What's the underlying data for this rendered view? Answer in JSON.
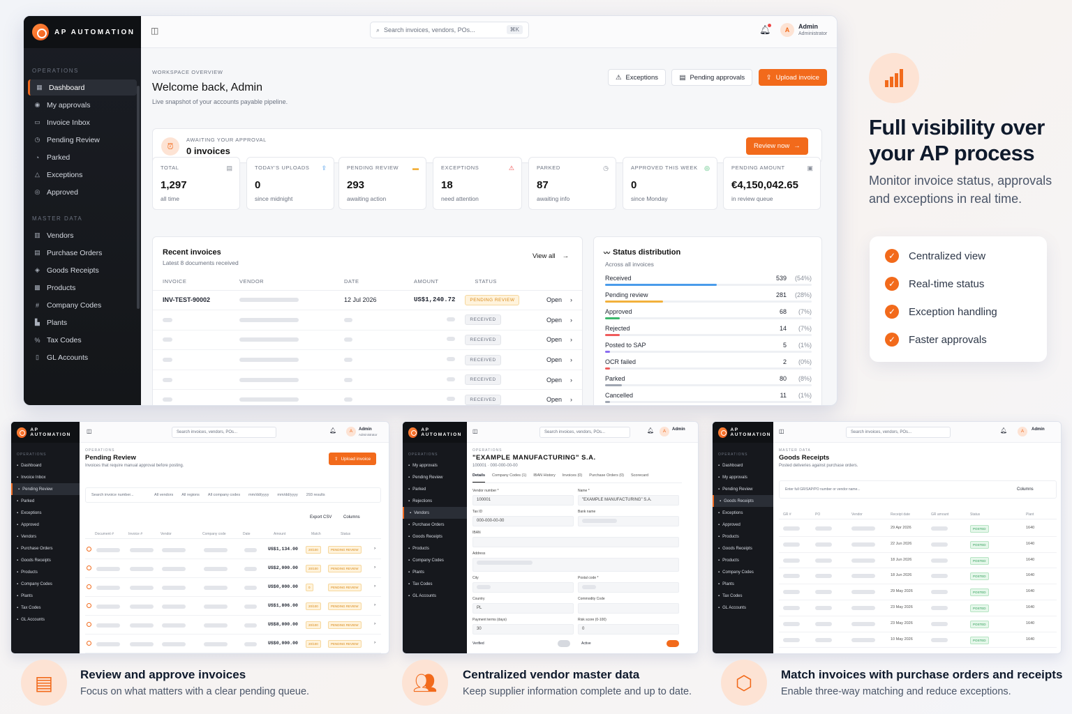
{
  "app": {
    "brand": "AP AUTOMATION",
    "search_placeholder": "Search invoices, vendors, POs...",
    "shortcut": "⌘K",
    "user_initial": "A",
    "user_name": "Admin",
    "user_role": "Administrator"
  },
  "sidebar": {
    "section_ops": "OPERATIONS",
    "section_master": "MASTER DATA",
    "ops": [
      {
        "label": "Dashboard",
        "icon": "grid-icon"
      },
      {
        "label": "My approvals",
        "icon": "user-check-icon"
      },
      {
        "label": "Invoice Inbox",
        "icon": "inbox-icon"
      },
      {
        "label": "Pending Review",
        "icon": "clock-icon"
      },
      {
        "label": "Parked",
        "icon": "pause-icon"
      },
      {
        "label": "Exceptions",
        "icon": "warning-icon"
      },
      {
        "label": "Approved",
        "icon": "check-circle-icon"
      }
    ],
    "master": [
      {
        "label": "Vendors",
        "icon": "building-icon"
      },
      {
        "label": "Purchase Orders",
        "icon": "document-icon"
      },
      {
        "label": "Goods Receipts",
        "icon": "box-icon"
      },
      {
        "label": "Products",
        "icon": "cubes-icon"
      },
      {
        "label": "Company Codes",
        "icon": "hash-icon"
      },
      {
        "label": "Plants",
        "icon": "factory-icon"
      },
      {
        "label": "Tax Codes",
        "icon": "percent-icon"
      },
      {
        "label": "GL Accounts",
        "icon": "book-icon"
      }
    ]
  },
  "header": {
    "eyebrow": "WORKSPACE OVERVIEW",
    "title": "Welcome back, Admin",
    "subtitle": "Live snapshot of your accounts payable pipeline.",
    "btn_exceptions": "Exceptions",
    "btn_pending": "Pending approvals",
    "btn_upload": "Upload invoice"
  },
  "approval": {
    "label": "AWAITING YOUR APPROVAL",
    "value": "0 invoices",
    "button": "Review now"
  },
  "stats": [
    {
      "label": "TOTAL",
      "value": "1,297",
      "sub": "all time"
    },
    {
      "label": "TODAY'S UPLOADS",
      "value": "0",
      "sub": "since midnight"
    },
    {
      "label": "PENDING REVIEW",
      "value": "293",
      "sub": "awaiting action"
    },
    {
      "label": "EXCEPTIONS",
      "value": "18",
      "sub": "need attention"
    },
    {
      "label": "PARKED",
      "value": "87",
      "sub": "awaiting info"
    },
    {
      "label": "APPROVED THIS WEEK",
      "value": "0",
      "sub": "since Monday"
    },
    {
      "label": "PENDING AMOUNT",
      "value": "€4,150,042.65",
      "sub": "in review queue"
    }
  ],
  "recent": {
    "title": "Recent invoices",
    "subtitle": "Latest 8 documents received",
    "view_all": "View all",
    "columns": [
      "INVOICE",
      "VENDOR",
      "DATE",
      "AMOUNT",
      "STATUS"
    ],
    "rows": [
      {
        "invoice": "INV-TEST-90002",
        "date": "12 Jul 2026",
        "amount": "US$1,240.72",
        "status": "PENDING REVIEW",
        "action": "Open"
      },
      {
        "status": "RECEIVED",
        "action": "Open"
      },
      {
        "status": "RECEIVED",
        "action": "Open"
      },
      {
        "status": "RECEIVED",
        "action": "Open"
      },
      {
        "status": "RECEIVED",
        "action": "Open"
      },
      {
        "status": "RECEIVED",
        "action": "Open"
      }
    ]
  },
  "distribution": {
    "title": "Status distribution",
    "subtitle": "Across all invoices",
    "items": [
      {
        "name": "Received",
        "count": "539",
        "pct": "(54%)",
        "frac": 0.54,
        "color": "#4a9bea"
      },
      {
        "name": "Pending review",
        "count": "281",
        "pct": "(28%)",
        "frac": 0.28,
        "color": "#f2b13c"
      },
      {
        "name": "Approved",
        "count": "68",
        "pct": "(7%)",
        "frac": 0.07,
        "color": "#3cb86b"
      },
      {
        "name": "Rejected",
        "count": "14",
        "pct": "(7%)",
        "frac": 0.07,
        "color": "#ef5b5b"
      },
      {
        "name": "Posted to SAP",
        "count": "5",
        "pct": "(1%)",
        "frac": 0.01,
        "color": "#8a6cf0"
      },
      {
        "name": "OCR failed",
        "count": "2",
        "pct": "(0%)",
        "frac": 0.005,
        "color": "#ef5b5b"
      },
      {
        "name": "Parked",
        "count": "80",
        "pct": "(8%)",
        "frac": 0.08,
        "color": "#a0a6b2"
      },
      {
        "name": "Cancelled",
        "count": "11",
        "pct": "(1%)",
        "frac": 0.01,
        "color": "#a0a6b2"
      }
    ]
  },
  "promo": {
    "title_line1": "Full visibility over",
    "title_line2": "your AP process",
    "sub_line1": "Monitor invoice status, approvals",
    "sub_line2": "and exceptions in real time.",
    "checks": [
      "Centralized view",
      "Real-time status",
      "Exception handling",
      "Faster approvals"
    ]
  },
  "mini1": {
    "eyebrow": "OPERATIONS",
    "title": "Pending Review",
    "subtitle": "Invoices that require manual approval before posting.",
    "upload": "Upload invoice",
    "search": "Search invoice number...",
    "f1": "All vendors",
    "f2": "All regions",
    "f3": "All company codes",
    "d1": "mm/dd/yyyy",
    "d2": "mm/dd/yyyy",
    "results": "293 results",
    "export": "Export CSV",
    "columns_btn": "Columns",
    "cols": [
      "Document #",
      "Invoice #",
      "Vendor",
      "Company code",
      "Date",
      "Amount",
      "Match",
      "Status"
    ],
    "amounts": [
      "US$1,134.00",
      "US$2,000.00",
      "US$0,000.00",
      "US$1,806.00",
      "US$8,000.00",
      "US$0,000.00"
    ],
    "match": [
      "20/100",
      "20/100",
      "0",
      "20/100",
      "20/100",
      "20/100"
    ],
    "status": "PENDING REVIEW",
    "nav": [
      "Dashboard",
      "Invoice Inbox",
      "Pending Review",
      "Parked",
      "Exceptions",
      "Approved",
      "Vendors",
      "Purchase Orders",
      "Goods Receipts",
      "Products",
      "Company Codes",
      "Plants",
      "Tax Codes",
      "GL Accounts"
    ]
  },
  "mini2": {
    "eyebrow": "OPERATIONS",
    "title": "\"EXAMPLE MANUFACTURING\" S.A.",
    "subtitle": "100001 · 000-000-00-00",
    "tabs": [
      "Details",
      "Company Codes (1)",
      "IBAN History",
      "Invoices (0)",
      "Purchase Orders (0)",
      "Scorecard"
    ],
    "vendor_label": "Vendor number *",
    "vendor": "100001",
    "name_label": "Name *",
    "name": "\"EXAMPLE MANUFACTURING\" S.A.",
    "tax_label": "Tax ID",
    "tax": "000-000-00-00",
    "bank_label": "Bank name",
    "iban_label": "IBAN",
    "address_label": "Address",
    "city_label": "City",
    "postal_label": "Postal code *",
    "country_label": "Country",
    "country": "PL",
    "commodity_label": "Commodity Code",
    "terms_label": "Payment terms (days)",
    "terms": "30",
    "risk_label": "Risk score (0-100)",
    "risk": "0",
    "verified": "Verified",
    "active": "Active",
    "nav": [
      "My approvals",
      "Pending Review",
      "Parked",
      "Rejections",
      "Vendors",
      "Purchase Orders",
      "Goods Receipts",
      "Products",
      "Company Codes",
      "Plants",
      "Tax Codes",
      "GL Accounts"
    ]
  },
  "mini3": {
    "eyebrow": "MASTER DATA",
    "title": "Goods Receipts",
    "subtitle": "Posted deliveries against purchase orders.",
    "search": "Enter full GR/SAP/PO number or vendor name...",
    "columns_btn": "Columns",
    "cols": [
      "GR #",
      "PO",
      "Vendor",
      "Receipt date",
      "GR amount",
      "Status",
      "Plant"
    ],
    "dates": [
      "29 Apr 2026",
      "22 Jun 2026",
      "18 Jun 2026",
      "18 Jun 2026",
      "29 May 2026",
      "23 May 2026",
      "23 May 2026",
      "10 May 2026"
    ],
    "status": "POSTED",
    "plant": "1640",
    "nav": [
      "Dashboard",
      "My approvals",
      "Pending Review",
      "Goods Receipts",
      "Exceptions",
      "Approved",
      "Products",
      "Goods Receipts",
      "Products",
      "Company Codes",
      "Plants",
      "Tax Codes",
      "GL Accounts"
    ]
  },
  "features": [
    {
      "title": "Review and approve invoices",
      "sub": "Focus on what matters with a clear pending queue."
    },
    {
      "title": "Centralized vendor master data",
      "sub": "Keep supplier information complete and up to date."
    },
    {
      "title": "Match invoices with purchase orders and receipts",
      "sub": "Enable three-way matching and reduce exceptions."
    }
  ]
}
